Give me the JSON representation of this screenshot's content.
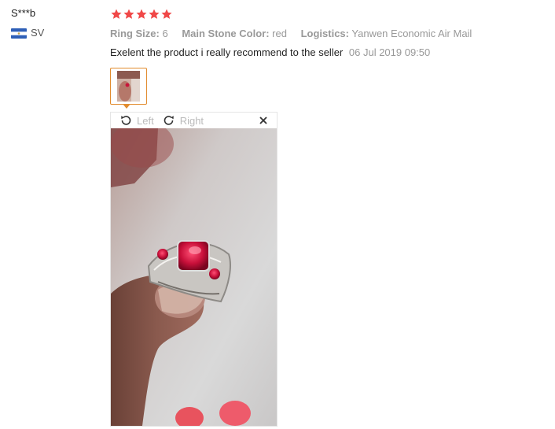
{
  "reviewer": {
    "name": "S***b",
    "country_code": "SV"
  },
  "rating": {
    "stars": 5,
    "max": 5,
    "color": "#f04848"
  },
  "attributes": [
    {
      "label": "Ring Size:",
      "value": "6"
    },
    {
      "label": "Main Stone Color:",
      "value": "red"
    },
    {
      "label": "Logistics:",
      "value": "Yanwen Economic Air Mail"
    }
  ],
  "review": {
    "text": "Exelent the product i really recommend to the seller",
    "date": "06 Jul 2019 09:50"
  },
  "viewer": {
    "rotate_left_label": "Left",
    "rotate_right_label": "Right",
    "icons": {
      "rotate_left": "rotate-left-icon",
      "rotate_right": "rotate-right-icon",
      "close": "close-icon"
    }
  },
  "colors": {
    "thumb_border": "#e28c2f",
    "flag_blue": "#2e5fb7",
    "muted_text": "#999999"
  }
}
